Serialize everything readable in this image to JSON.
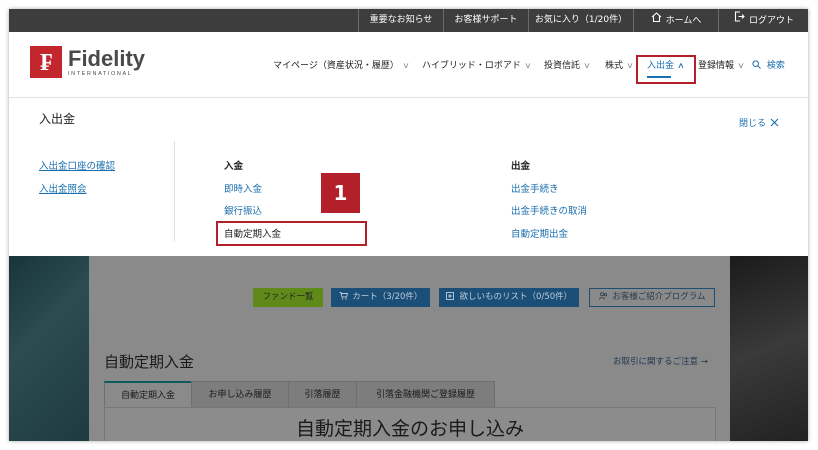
{
  "topbar": {
    "items": [
      "重要なお知らせ",
      "お客様サポート",
      "お気に入り（1/20件）",
      "ホームへ",
      "ログアウト"
    ]
  },
  "logo": {
    "name": "Fidelity",
    "sub": "INTERNATIONAL",
    "mark": "₣"
  },
  "nav": {
    "items": [
      "マイページ（資産状況・履歴）",
      "ハイブリッド・ロボアド",
      "投資信託",
      "株式",
      "入出金",
      "登録情報",
      "検索"
    ],
    "active": "入出金"
  },
  "dropdown": {
    "title": "入出金",
    "close": "閉じる",
    "left_links": [
      "入出金口座の確認",
      "入出金照会"
    ],
    "deposit": {
      "heading": "入金",
      "items": [
        "即時入金",
        "銀行振込",
        "自動定期入金"
      ]
    },
    "withdraw": {
      "heading": "出金",
      "items": [
        "出金手続き",
        "出金手続きの取消",
        "自動定期出金"
      ]
    },
    "step_badge": "1"
  },
  "page": {
    "buttons": {
      "fund_list": "ファンド一覧",
      "cart": "カート（3/20件）",
      "wishlist": "欲しいものリスト（0/50件）",
      "referral": "お客様ご紹介プログラム"
    },
    "title": "自動定期入金",
    "notice": "お取引に関するご注意",
    "tabs": [
      "自動定期入金",
      "お申し込み履歴",
      "引落履歴",
      "引落金融機関ご登録履歴"
    ],
    "heading": "自動定期入金のお申し込み"
  },
  "colors": {
    "brand_red": "#c4262e",
    "link_blue": "#1a6fae",
    "highlight": "#b3202a",
    "topbar_bg": "#3d3d3d"
  }
}
